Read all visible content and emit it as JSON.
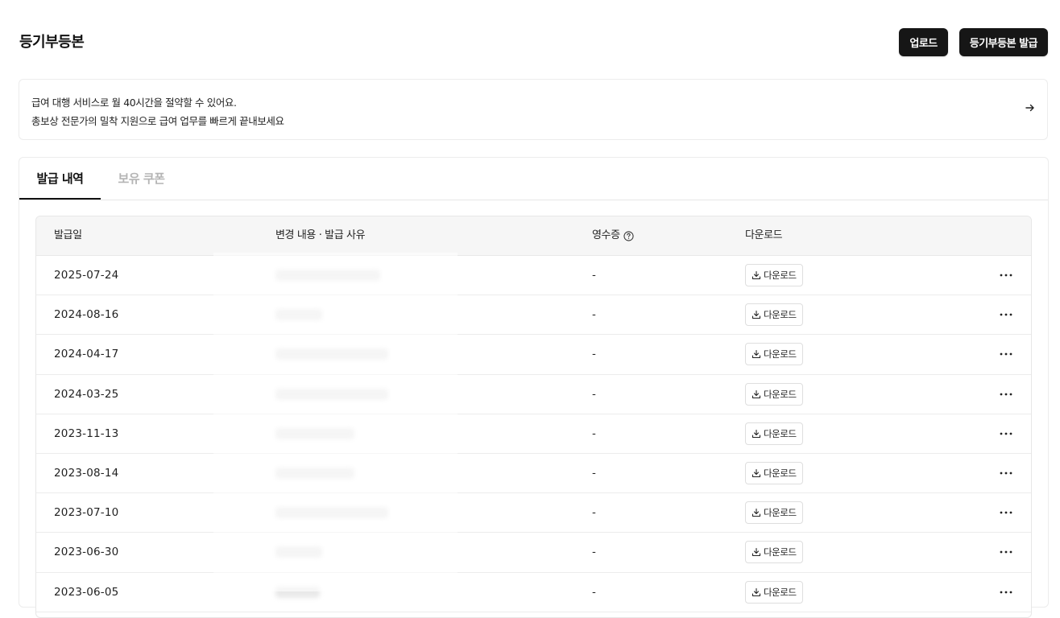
{
  "header": {
    "title": "등기부등본",
    "upload_label": "업로드",
    "issue_label": "등기부등본 발급"
  },
  "banner": {
    "line1": "급여 대행 서비스로 월 40시간을 절약할 수 있어요.",
    "line2": "총보상 전문가의 밀착 지원으로 급여 업무를 빠르게 끝내보세요",
    "arrow_icon": "arrow-right-icon"
  },
  "tabs": [
    {
      "label": "발급 내역",
      "active": true
    },
    {
      "label": "보유 쿠폰",
      "active": false
    }
  ],
  "table": {
    "columns": [
      "발급일",
      "변경 내용 · 발급 사유",
      "영수증",
      "다운로드"
    ],
    "download_label": "다운로드",
    "rows": [
      {
        "date": "2025-07-24",
        "receipt": "-"
      },
      {
        "date": "2024-08-16",
        "receipt": "-"
      },
      {
        "date": "2024-04-17",
        "receipt": "-"
      },
      {
        "date": "2024-03-25",
        "receipt": "-"
      },
      {
        "date": "2023-11-13",
        "receipt": "-"
      },
      {
        "date": "2023-08-14",
        "receipt": "-"
      },
      {
        "date": "2023-07-10",
        "receipt": "-"
      },
      {
        "date": "2023-06-30",
        "receipt": "-"
      },
      {
        "date": "2023-06-05",
        "receipt": "-"
      }
    ]
  },
  "colors": {
    "primary_button": "#161616",
    "border": "#ececec",
    "header_bg": "#f6f6f6",
    "inactive_tab": "#b5b5b5"
  }
}
